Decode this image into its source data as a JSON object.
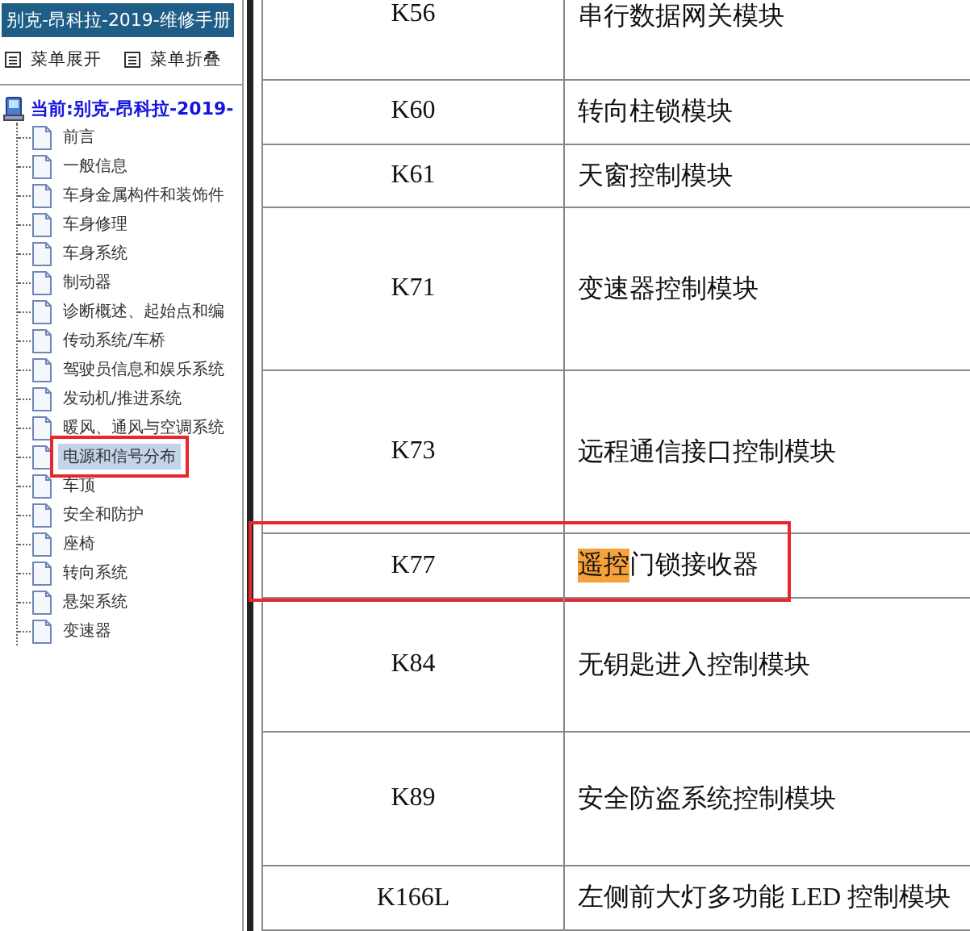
{
  "sidebar": {
    "title": "别克-昂科拉-2019-维修手册",
    "toolbar": [
      {
        "label": "菜单展开"
      },
      {
        "label": "菜单折叠"
      }
    ],
    "tree": {
      "label": "当前:别克-昂科拉-2019-",
      "children": [
        {
          "label": "前言",
          "selected": false,
          "annotated": false
        },
        {
          "label": "一般信息",
          "selected": false,
          "annotated": false
        },
        {
          "label": "车身金属构件和装饰件",
          "selected": false,
          "annotated": false
        },
        {
          "label": "车身修理",
          "selected": false,
          "annotated": false
        },
        {
          "label": "车身系统",
          "selected": false,
          "annotated": false
        },
        {
          "label": "制动器",
          "selected": false,
          "annotated": false
        },
        {
          "label": "诊断概述、起始点和编",
          "selected": false,
          "annotated": false
        },
        {
          "label": "传动系统/车桥",
          "selected": false,
          "annotated": false
        },
        {
          "label": "驾驶员信息和娱乐系统",
          "selected": false,
          "annotated": false
        },
        {
          "label": "发动机/推进系统",
          "selected": false,
          "annotated": false
        },
        {
          "label": "暖风、通风与空调系统",
          "selected": false,
          "annotated": false
        },
        {
          "label": "电源和信号分布",
          "selected": true,
          "annotated": true
        },
        {
          "label": "车顶",
          "selected": false,
          "annotated": false
        },
        {
          "label": "安全和防护",
          "selected": false,
          "annotated": false
        },
        {
          "label": "座椅",
          "selected": false,
          "annotated": false
        },
        {
          "label": "转向系统",
          "selected": false,
          "annotated": false
        },
        {
          "label": "悬架系统",
          "selected": false,
          "annotated": false
        },
        {
          "label": "变速器",
          "selected": false,
          "annotated": false
        }
      ]
    }
  },
  "table": {
    "rows": [
      {
        "code": "K56",
        "name": [
          {
            "text": "串行数据网关模块",
            "highlighted": false
          }
        ],
        "annotated": false
      },
      {
        "code": "K60",
        "name": [
          {
            "text": "转向柱锁模块",
            "highlighted": false
          }
        ],
        "annotated": false
      },
      {
        "code": "K61",
        "name": [
          {
            "text": "天窗控制模块",
            "highlighted": false
          }
        ],
        "annotated": false
      },
      {
        "code": "K71",
        "name": [
          {
            "text": "变速器控制模块",
            "highlighted": false
          }
        ],
        "annotated": false
      },
      {
        "code": "K73",
        "name": [
          {
            "text": "远程通信接口控制模块",
            "highlighted": false
          }
        ],
        "annotated": false
      },
      {
        "code": "K77",
        "name": [
          {
            "text": "遥控",
            "highlighted": true
          },
          {
            "text": "门锁接收器",
            "highlighted": false
          }
        ],
        "annotated": true
      },
      {
        "code": "K84",
        "name": [
          {
            "text": "无钥匙进入控制模块",
            "highlighted": false
          }
        ],
        "annotated": false
      },
      {
        "code": "K89",
        "name": [
          {
            "text": "安全防盗系统控制模块",
            "highlighted": false
          }
        ],
        "annotated": false
      },
      {
        "code": "K166L",
        "name": [
          {
            "text": "左侧前大灯多功能 LED 控制模块",
            "highlighted": false
          }
        ],
        "annotated": false
      }
    ]
  }
}
